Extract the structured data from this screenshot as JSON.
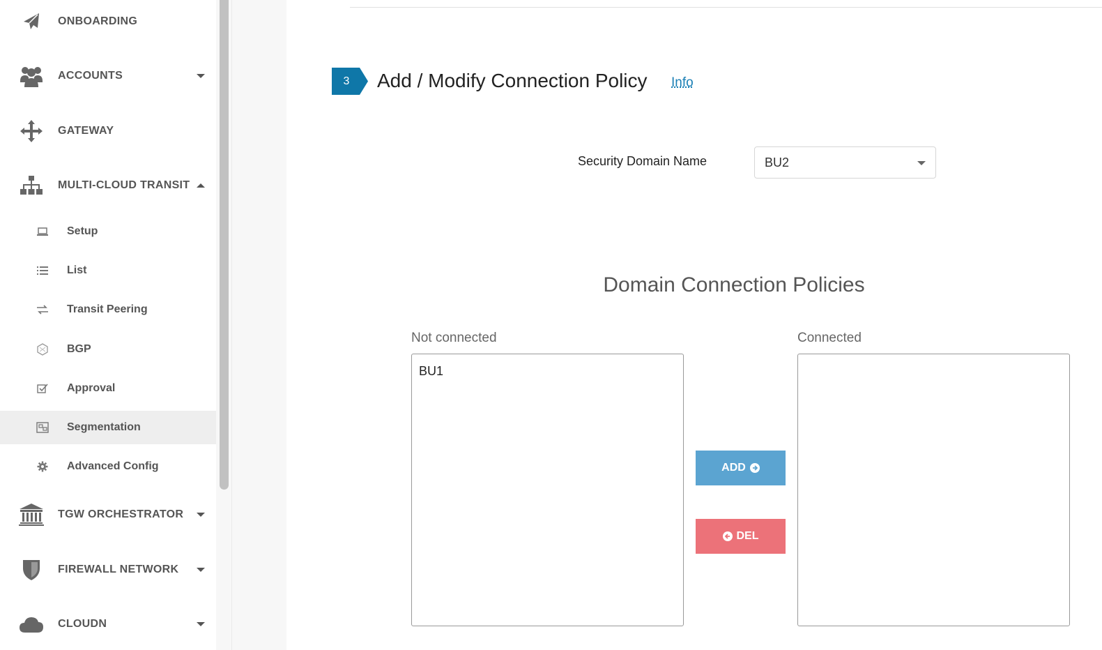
{
  "sidebar": {
    "items": [
      {
        "label": "ONBOARDING",
        "icon": "plane-icon"
      },
      {
        "label": "ACCOUNTS",
        "icon": "users-icon"
      },
      {
        "label": "GATEWAY",
        "icon": "move-arrows-icon"
      },
      {
        "label": "MULTI-CLOUD TRANSIT",
        "icon": "sitemap-icon",
        "expanded": true
      },
      {
        "label": "TGW ORCHESTRATOR",
        "icon": "bank-icon"
      },
      {
        "label": "FIREWALL NETWORK",
        "icon": "shield-icon"
      },
      {
        "label": "CLOUDN",
        "icon": "cloud-icon"
      }
    ],
    "subitems": [
      {
        "label": "Setup",
        "icon": "laptop-icon"
      },
      {
        "label": "List",
        "icon": "list-icon"
      },
      {
        "label": "Transit Peering",
        "icon": "exchange-icon"
      },
      {
        "label": "BGP",
        "icon": "bgp-icon"
      },
      {
        "label": "Approval",
        "icon": "check-square-icon"
      },
      {
        "label": "Segmentation",
        "icon": "segment-icon",
        "active": true
      },
      {
        "label": "Advanced Config",
        "icon": "cog-icon"
      }
    ]
  },
  "main": {
    "step_number": "3",
    "section_title": "Add / Modify Connection Policy",
    "info_link": "Info",
    "domain_label": "Security Domain Name",
    "domain_value": "BU2",
    "policies_title": "Domain Connection Policies",
    "not_connected_label": "Not connected",
    "not_connected_items": [
      "BU1"
    ],
    "connected_label": "Connected",
    "connected_items": [],
    "add_button": "ADD",
    "del_button": "DEL"
  },
  "colors": {
    "step_badge": "#0f77a8",
    "add_button": "#5ba4d1",
    "del_button": "#ec7279",
    "link": "#1a7fb5"
  }
}
